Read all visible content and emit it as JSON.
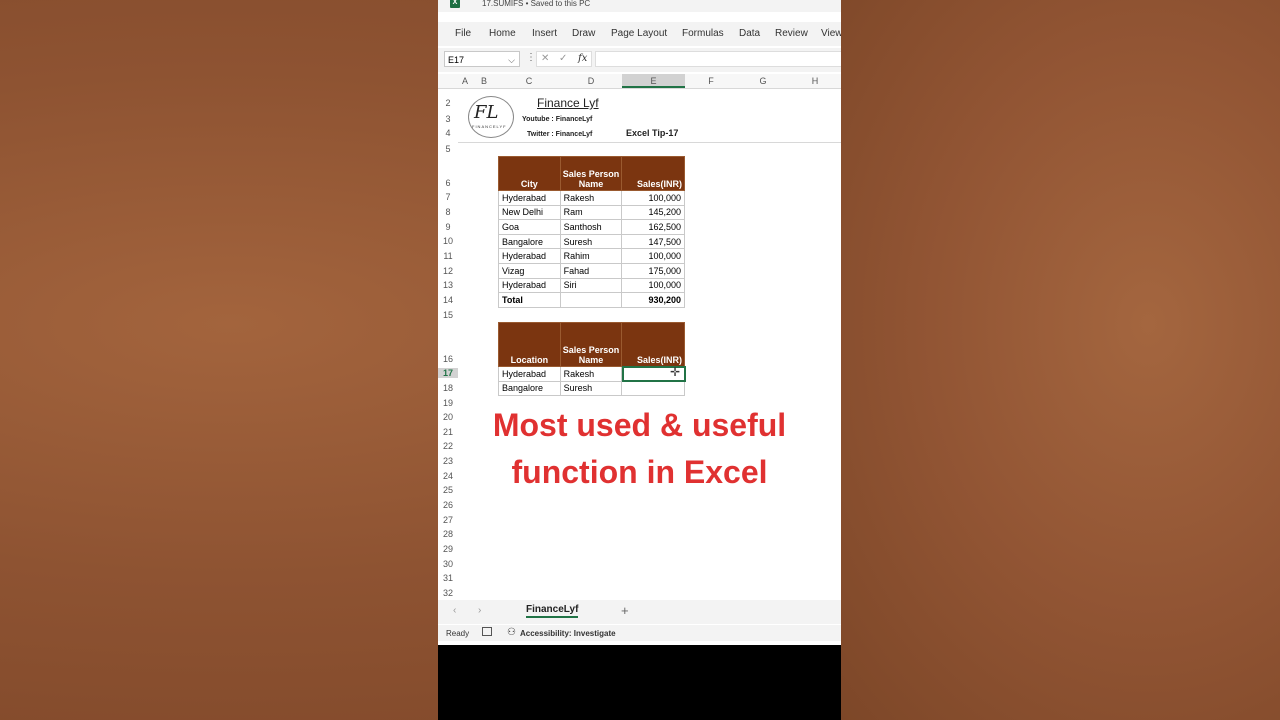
{
  "app": {
    "document_title": "17.SUMIFS • Saved to this PC",
    "menu": [
      "File",
      "Home",
      "Insert",
      "Draw",
      "Page Layout",
      "Formulas",
      "Data",
      "Review",
      "View"
    ]
  },
  "formula_bar": {
    "name_box": "E17",
    "formula": ""
  },
  "columns": [
    "A",
    "B",
    "C",
    "D",
    "E",
    "F",
    "G",
    "H"
  ],
  "rows": [
    "2",
    "3",
    "4",
    "5",
    "6",
    "7",
    "8",
    "9",
    "10",
    "11",
    "12",
    "13",
    "14",
    "15",
    "16",
    "17",
    "18",
    "19",
    "20",
    "21",
    "22",
    "23",
    "24",
    "25",
    "26",
    "27",
    "28",
    "29",
    "30",
    "31",
    "32"
  ],
  "header": {
    "brand": "Finance Lyf",
    "youtube": "Youtube : FinanceLyf",
    "twitter": "Twitter : FinanceLyf",
    "tip": "Excel Tip-17",
    "logo_text": "FL",
    "logo_sub": "FINANCELYF"
  },
  "table1": {
    "headers": [
      "City",
      "Sales Person Name",
      "Sales(INR)"
    ],
    "rows": [
      [
        "Hyderabad",
        "Rakesh",
        "100,000"
      ],
      [
        "New Delhi",
        "Ram",
        "145,200"
      ],
      [
        "Goa",
        "Santhosh",
        "162,500"
      ],
      [
        "Bangalore",
        "Suresh",
        "147,500"
      ],
      [
        "Hyderabad",
        "Rahim",
        "100,000"
      ],
      [
        "Vizag",
        "Fahad",
        "175,000"
      ],
      [
        "Hyderabad",
        "Siri",
        "100,000"
      ]
    ],
    "total_label": "Total",
    "total_value": "930,200"
  },
  "table2": {
    "headers": [
      "Location",
      "Sales Person Name",
      "Sales(INR)"
    ],
    "rows": [
      [
        "Hyderabad",
        "Rakesh",
        ""
      ],
      [
        "Bangalore",
        "Suresh",
        ""
      ]
    ]
  },
  "overlay": {
    "line1": "Most used & useful",
    "line2": "function in Excel"
  },
  "sheet_tabs": {
    "active": "FinanceLyf",
    "add": "+"
  },
  "status": {
    "ready": "Ready",
    "accessibility": "Accessibility: Investigate"
  },
  "colors": {
    "header_fill": "#7b3510",
    "overlay_text": "#e03131",
    "excel_green": "#217346"
  }
}
